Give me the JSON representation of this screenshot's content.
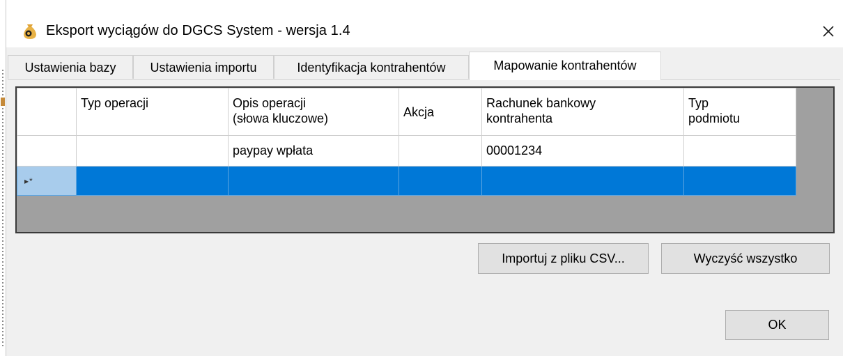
{
  "window": {
    "title": "Eksport wyciągów do DGCS System - wersja 1.4",
    "icon": "money-bag-icon",
    "close_glyph": "✕"
  },
  "tabs": [
    {
      "label": "Ustawienia bazy",
      "active": false
    },
    {
      "label": "Ustawienia importu",
      "active": false
    },
    {
      "label": "Identyfikacja kontrahentów",
      "active": false
    },
    {
      "label": "Mapowanie kontrahentów",
      "active": true
    }
  ],
  "grid": {
    "columns": [
      {
        "label_line1": "Typ operacji",
        "label_line2": ""
      },
      {
        "label_line1": "Opis operacji",
        "label_line2": "(słowa kluczowe)"
      },
      {
        "label_line1": "Akcja",
        "label_line2": ""
      },
      {
        "label_line1": "Rachunek bankowy",
        "label_line2": "kontrahenta"
      },
      {
        "label_line1": "Typ",
        "label_line2": "podmiotu"
      }
    ],
    "rows": [
      {
        "typ_operacji": "",
        "opis_operacji": "paypay wpłata",
        "akcja": "",
        "rachunek": "00001234",
        "typ_podmiotu": ""
      }
    ],
    "new_row_marker": "▸*",
    "selection_color": "#0078d7"
  },
  "buttons": {
    "import_csv": "Importuj z pliku CSV...",
    "clear_all": "Wyczyść wszystko",
    "ok": "OK"
  }
}
